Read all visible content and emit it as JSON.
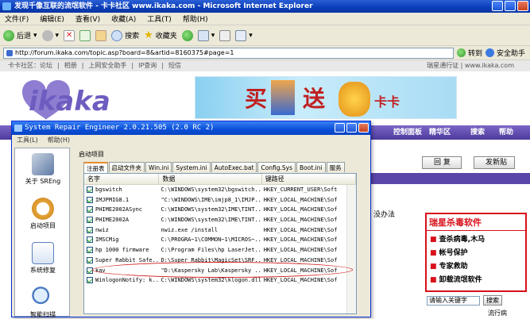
{
  "ie": {
    "title": "发现千像互联的流氓软件 - 卡卡社区 www.ikaka.com - Microsoft Internet Explorer",
    "menu": [
      "文件(F)",
      "编辑(E)",
      "查看(V)",
      "收藏(A)",
      "工具(T)",
      "帮助(H)"
    ],
    "toolbar": {
      "back": "后退",
      "search": "搜索",
      "favorites": "收藏夹"
    },
    "address": "http://forum.ikaka.com/topic.asp?board=8&artid=8160375#page=1",
    "go": "转到",
    "security": "安全助手"
  },
  "site": {
    "nav": [
      "卡卡社区：论坛",
      "相册",
      "上网安全助手",
      "IP查询",
      "短信"
    ],
    "nav_right": "瑞星通行证 | www.ikaka.com",
    "logo_text": "ikaka",
    "banner_text": [
      "买",
      "送",
      "卡卡"
    ],
    "purple_items": [
      "控制面板",
      "精华区",
      "搜索",
      "帮助"
    ],
    "btn_reply": "回 复",
    "btn_post": "发新贴",
    "virus_title": "瑞星杀毒软件",
    "virus_items": [
      "查杀病毒,木马",
      "帐号保护",
      "专家救助",
      "卸载流氓软件"
    ],
    "search_placeholder": "请输入关键字",
    "search_btn": "搜索",
    "tail": "流行病",
    "footer_text": "没办法"
  },
  "dialog": {
    "title": "System Repair Engineer 2.0.21.505 (2.0 RC 2)",
    "menu": [
      "工具(L)",
      "帮助(H)"
    ],
    "nav": [
      {
        "label": "关于 SREng",
        "icon": "tools-icon"
      },
      {
        "label": "启动项目",
        "icon": "clock-icon"
      },
      {
        "label": "系统修复",
        "icon": "checklist-icon"
      },
      {
        "label": "智能扫描",
        "icon": "magnifier-icon"
      }
    ],
    "section": "启动项目",
    "tabs": [
      "注册表",
      "启动文件夹",
      "Win.ini",
      "System.ini",
      "AutoExec.bat",
      "Config.Sys",
      "Boot.ini",
      "服务"
    ],
    "columns": [
      "名字",
      "数据",
      "键路径"
    ],
    "rows": [
      {
        "name": "bgswitch",
        "data": "C:\\WINDOWS\\system32\\bgswitch....",
        "path": "HKEY_CURRENT_USER\\Soft"
      },
      {
        "name": "IMJPMIG8.1",
        "data": "\"C:\\WINDOWS\\IME\\imjp8_1\\IMJP...",
        "path": "HKEY_LOCAL_MACHINE\\Sof"
      },
      {
        "name": "PHIME2002ASync",
        "data": "C:\\WINDOWS\\system32\\IME\\TINT...",
        "path": "HKEY_LOCAL_MACHINE\\Sof"
      },
      {
        "name": "PHIME2002A",
        "data": "C:\\WINDOWS\\system32\\IME\\TINT...",
        "path": "HKEY_LOCAL_MACHINE\\Sof"
      },
      {
        "name": "nwiz",
        "data": "nwiz.exe /install",
        "path": "HKEY_LOCAL_MACHINE\\Sof"
      },
      {
        "name": "IMSCMig",
        "data": "C:\\PROGRA~1\\COMMON~1\\MICROS~...",
        "path": "HKEY_LOCAL_MACHINE\\Sof"
      },
      {
        "name": "hp 1000 firmware",
        "data": "C:\\Program Files\\hp LaserJet...",
        "path": "HKEY_LOCAL_MACHINE\\Sof"
      },
      {
        "name": "Super Rabbit Safe...",
        "data": "D:\\Super Rabbit\\MagicSet\\SRF...",
        "path": "HKEY_LOCAL_MACHINE\\Sof"
      },
      {
        "name": "kav",
        "data": "\"D:\\Kaspersky Lab\\Kaspersky ...",
        "path": "HKEY_LOCAL_MACHINE\\Sof"
      },
      {
        "name": "WinlogonNotify: k...",
        "data": "C:\\WINDOWS\\system32\\klogon.dll",
        "path": "HKEY_LOCAL_MACHINE\\Sof"
      }
    ]
  }
}
